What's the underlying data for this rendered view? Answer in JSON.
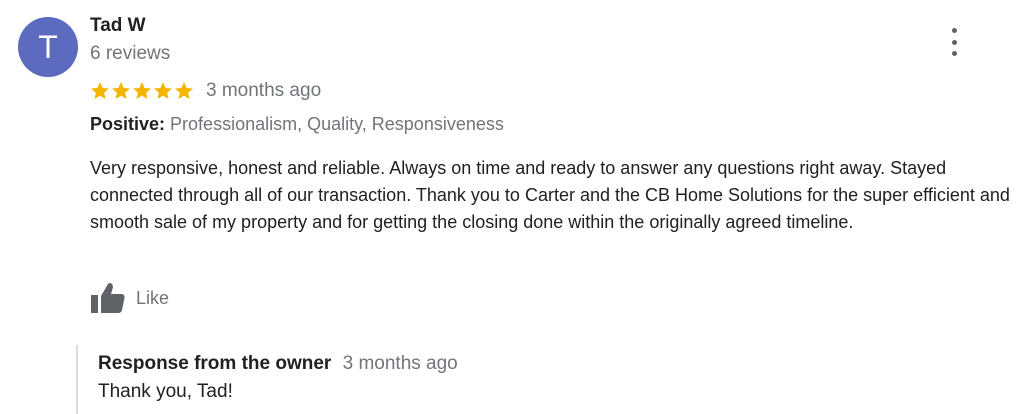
{
  "review": {
    "author": {
      "initial": "T",
      "name": "Tad W",
      "review_count": "6 reviews",
      "avatar_color": "#5c6bc0"
    },
    "rating": 5,
    "rating_max": 5,
    "star_color": "#f4b400",
    "time_ago": "3 months ago",
    "attributes": {
      "label": "Positive:",
      "values": "Professionalism, Quality, Responsiveness"
    },
    "text": "Very responsive, honest and reliable. Always on time and ready to answer any questions right away. Stayed connected through all of our transaction. Thank you to Carter and the CB Home Solutions for the super efficient and smooth sale of my property and for getting the closing done within the originally agreed timeline.",
    "like_label": "Like",
    "owner_response": {
      "title": "Response from the owner",
      "time_ago": "3 months ago",
      "text": "Thank you, Tad!"
    }
  },
  "icons": {
    "more": "more-vert-icon",
    "star": "star-icon",
    "like": "thumbs-up-icon"
  }
}
